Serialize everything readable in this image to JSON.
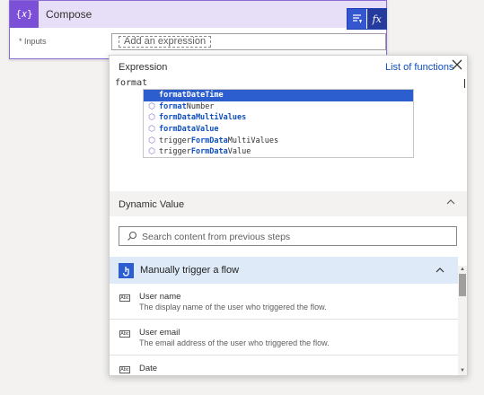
{
  "compose": {
    "icon_text": "{𝑥}",
    "title": "Compose",
    "inputs_label": "* Inputs",
    "expression_token": "Add an expression"
  },
  "toolbar": {
    "dynamic_icon": "dynamic-content-icon",
    "fx_label": "fx"
  },
  "expression_panel": {
    "title": "Expression",
    "list_functions_link": "List of functions",
    "close_icon": "close-icon",
    "input_value": "format",
    "suggestions": [
      {
        "match": "format",
        "rest": "DateTime",
        "selected": true
      },
      {
        "match": "format",
        "rest": "Number",
        "selected": false
      },
      {
        "match": "formDataMultiValues",
        "rest": "",
        "selected": false
      },
      {
        "match": "formDataValue",
        "rest": "",
        "selected": false
      },
      {
        "prefix": "trigger",
        "match": "FormData",
        "rest": "MultiValues",
        "selected": false
      },
      {
        "prefix": "trigger",
        "match": "FormData",
        "rest": "Value",
        "selected": false
      }
    ]
  },
  "dynamic_value": {
    "title": "Dynamic Value",
    "search_placeholder": "Search content from previous steps"
  },
  "trigger": {
    "title": "Manually trigger a flow",
    "items": [
      {
        "name": "User name",
        "description": "The display name of the user who triggered the flow.",
        "type": "Abc"
      },
      {
        "name": "User email",
        "description": "The email address of the user who triggered the flow.",
        "type": "Abc"
      },
      {
        "name": "Date",
        "description": "",
        "type": "Abc"
      }
    ]
  },
  "colors": {
    "accent_purple": "#7b4fd6",
    "link_blue": "#0f4fbf",
    "selection_blue": "#2c5ecf",
    "trigger_bg": "#deeaf8"
  }
}
